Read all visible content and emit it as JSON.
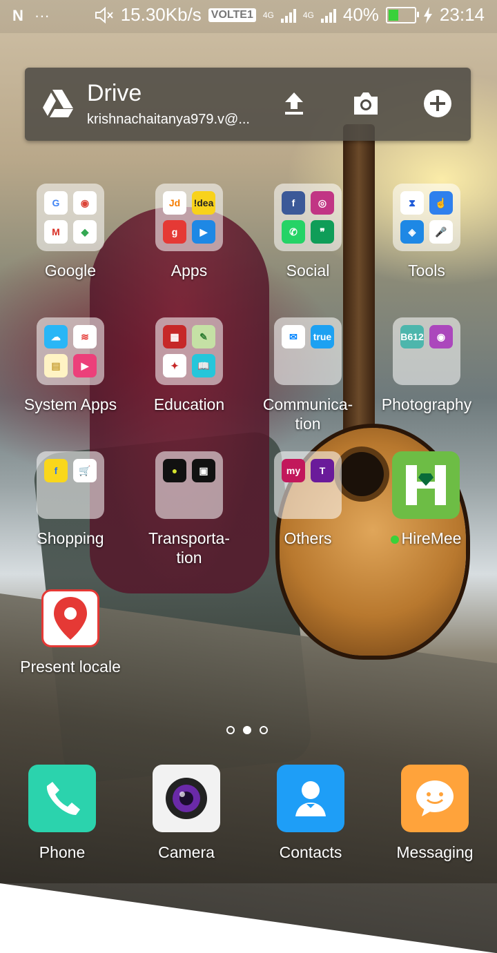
{
  "status_bar": {
    "speed": "15.30Kb/s",
    "volte": "VOLTE1",
    "net1": "4G",
    "net2": "4G",
    "battery": "40%",
    "battery_level": 0.4,
    "time": "23:14",
    "icons": [
      "n-icon",
      "more-icon",
      "mute-icon",
      "signal-icon",
      "battery-icon",
      "charging-icon"
    ]
  },
  "drive_widget": {
    "title": "Drive",
    "account": "krishnachaitanya979.v@...",
    "actions": [
      "upload-icon",
      "camera-icon",
      "add-icon"
    ]
  },
  "folders": [
    {
      "label": "Google",
      "apps": [
        {
          "t": "G",
          "c": "#ffffff",
          "fg": "#4285f4"
        },
        {
          "t": "◉",
          "c": "#ffffff",
          "fg": "#db4437"
        },
        {
          "t": "M",
          "c": "#ffffff",
          "fg": "#d93025"
        },
        {
          "t": "◆",
          "c": "#ffffff",
          "fg": "#34a853"
        }
      ]
    },
    {
      "label": "Apps",
      "apps": [
        {
          "t": "Jd",
          "c": "#ffffff",
          "fg": "#f57c00"
        },
        {
          "t": "!dea",
          "c": "#f8d21b",
          "fg": "#222"
        },
        {
          "t": "g",
          "c": "#e53935",
          "fg": "#fff"
        },
        {
          "t": "▶",
          "c": "#1e88e5",
          "fg": "#fff"
        }
      ]
    },
    {
      "label": "Social",
      "apps": [
        {
          "t": "f",
          "c": "#3b5998",
          "fg": "#fff"
        },
        {
          "t": "◎",
          "c": "#c13584",
          "fg": "#fff"
        },
        {
          "t": "✆",
          "c": "#25d366",
          "fg": "#fff"
        },
        {
          "t": "❞",
          "c": "#0f9d58",
          "fg": "#fff"
        }
      ]
    },
    {
      "label": "Tools",
      "apps": [
        {
          "t": "⧗",
          "c": "#ffffff",
          "fg": "#1e5ad8"
        },
        {
          "t": "☝",
          "c": "#2f80ed",
          "fg": "#fff"
        },
        {
          "t": "◈",
          "c": "#1e88e5",
          "fg": "#fff"
        },
        {
          "t": "🎤",
          "c": "#ffffff",
          "fg": "#4285f4"
        }
      ]
    },
    {
      "label": "System Apps",
      "apps": [
        {
          "t": "☁",
          "c": "#29b6f6",
          "fg": "#fff"
        },
        {
          "t": "≋",
          "c": "#ffffff",
          "fg": "#e53935"
        },
        {
          "t": "▤",
          "c": "#fff3c4",
          "fg": "#c9a23a"
        },
        {
          "t": "▶",
          "c": "#ec407a",
          "fg": "#fff"
        }
      ]
    },
    {
      "label": "Education",
      "apps": [
        {
          "t": "▦",
          "c": "#c62828",
          "fg": "#fff"
        },
        {
          "t": "✎",
          "c": "#c5e1a5",
          "fg": "#2e7d32"
        },
        {
          "t": "✦",
          "c": "#ffffff",
          "fg": "#c62828"
        },
        {
          "t": "📖",
          "c": "#26c6da",
          "fg": "#fff"
        }
      ]
    },
    {
      "label": "Communica-\ntion",
      "apps": [
        {
          "t": "✉",
          "c": "#ffffff",
          "fg": "#0084ff"
        },
        {
          "t": "true",
          "c": "#1da1f2",
          "fg": "#fff"
        }
      ]
    },
    {
      "label": "Photography",
      "apps": [
        {
          "t": "B612",
          "c": "#4db6ac",
          "fg": "#fff"
        },
        {
          "t": "◉",
          "c": "#ab47bc",
          "fg": "#fff"
        }
      ]
    },
    {
      "label": "Shopping",
      "apps": [
        {
          "t": "f",
          "c": "#f9d71c",
          "fg": "#2874f0"
        },
        {
          "t": "🛒",
          "c": "#ffffff",
          "fg": "#232f3e"
        }
      ]
    },
    {
      "label": "Transporta-\ntion",
      "apps": [
        {
          "t": "●",
          "c": "#111111",
          "fg": "#d4e22d"
        },
        {
          "t": "▣",
          "c": "#111111",
          "fg": "#fff"
        }
      ]
    },
    {
      "label": "Others",
      "apps": [
        {
          "t": "my",
          "c": "#c2185b",
          "fg": "#fff"
        },
        {
          "t": "T",
          "c": "#6a1b9a",
          "fg": "#fff"
        }
      ]
    }
  ],
  "apps": [
    {
      "label": "HireMee",
      "color": "#6dbd45",
      "new": true
    },
    {
      "label": "Present locale",
      "color": "#ffffff"
    }
  ],
  "page_dots": {
    "count": 3,
    "active": 1
  },
  "dock": [
    {
      "label": "Phone",
      "color": "#2bd3ad"
    },
    {
      "label": "Camera",
      "color": "#f2f2f2"
    },
    {
      "label": "Contacts",
      "color": "#1e9ef7"
    },
    {
      "label": "Messaging",
      "color": "#ffa33b"
    }
  ]
}
